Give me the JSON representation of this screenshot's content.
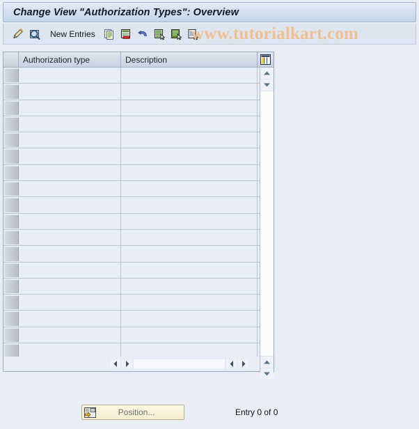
{
  "window": {
    "title": "Change View \"Authorization Types\": Overview"
  },
  "watermark": {
    "text": "www.tutorialkart.com",
    "color": "#f0c090"
  },
  "toolbar": {
    "buttons": [
      {
        "icon": "pencil-display-change-icon",
        "label": ""
      },
      {
        "icon": "magnifier-display-icon",
        "label": ""
      }
    ],
    "new_entries_label": "New Entries",
    "action_icons": [
      "copy-as-icon",
      "delete-row-icon",
      "undo-icon",
      "select-all-icon",
      "select-block-icon",
      "deselect-all-icon"
    ]
  },
  "table": {
    "columns": [
      {
        "key": "auth_type",
        "label": "Authorization type"
      },
      {
        "key": "description",
        "label": "Description"
      }
    ],
    "config_icon": "table-settings-icon",
    "row_count": 18,
    "rows": []
  },
  "scrollbars": {
    "vertical": {
      "up_icon": "triangle-up-icon",
      "down_icon": "triangle-down-icon"
    },
    "horizontal": {
      "left_icon": "triangle-left-icon",
      "right_icon": "triangle-right-icon"
    }
  },
  "footer": {
    "position_button": {
      "label": "Position...",
      "icon": "position-icon"
    },
    "entry_status": "Entry 0 of 0"
  },
  "colors": {
    "page_background": "#e9eef6",
    "title_bar": "#d3e0f0",
    "toolbar": "#dde5f0",
    "grid_line": "#b9c5d4",
    "header_border": "#9db0c6",
    "button_yellow": "#f6edcf"
  }
}
